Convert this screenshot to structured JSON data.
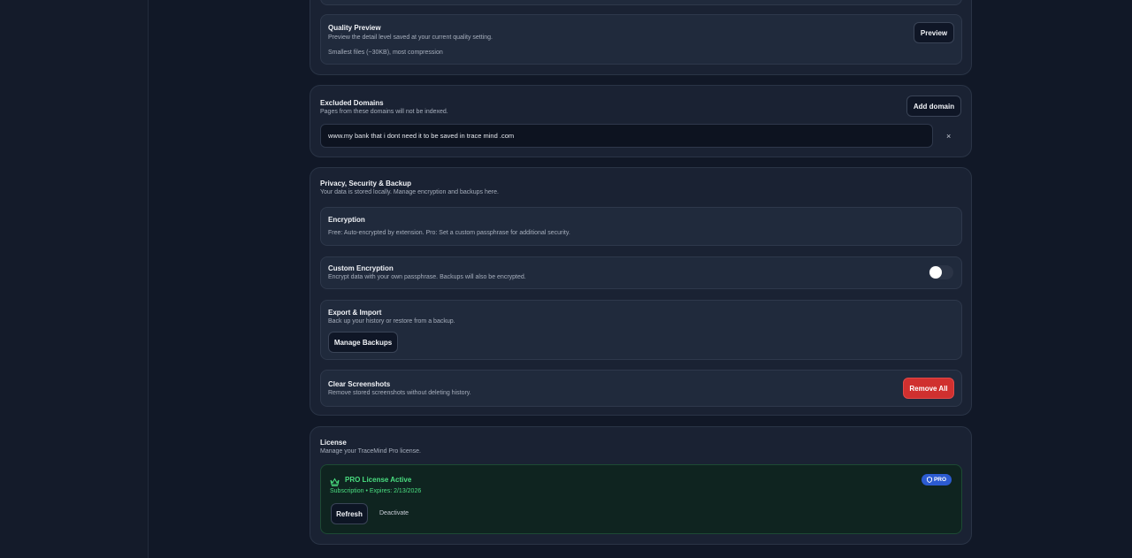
{
  "quality_preview": {
    "title": "Quality Preview",
    "description": "Preview the detail level saved at your current quality setting.",
    "note": "Smallest files (~30KB), most compression",
    "button": "Preview"
  },
  "excluded_domains": {
    "title": "Excluded Domains",
    "description": "Pages from these domains will not be indexed.",
    "add_button": "Add domain",
    "domain_value": "www.my bank that i dont need it to be saved in trace mind .com",
    "remove_glyph": "×"
  },
  "privacy": {
    "title": "Privacy, Security & Backup",
    "description": "Your data is stored locally. Manage encryption and backups here.",
    "encryption": {
      "title": "Encryption",
      "description": "Free: Auto-encrypted by extension. Pro: Set a custom passphrase for additional security."
    },
    "custom_encryption": {
      "title": "Custom Encryption",
      "description": "Encrypt data with your own passphrase. Backups will also be encrypted.",
      "enabled": false
    },
    "export_import": {
      "title": "Export & Import",
      "description": "Back up your history or restore from a backup.",
      "button": "Manage Backups"
    },
    "clear_screenshots": {
      "title": "Clear Screenshots",
      "description": "Remove stored screenshots without deleting history.",
      "button": "Remove All"
    }
  },
  "license": {
    "title": "License",
    "description": "Manage your TraceMind Pro license.",
    "status": "PRO License Active",
    "details": "Subscription • Expires: 2/13/2026",
    "badge": "PRO",
    "refresh_button": "Refresh",
    "deactivate_button": "Deactivate"
  },
  "colors": {
    "accent_green": "#4ade80",
    "danger": "#d0302f",
    "badge_blue": "#2c5bd1"
  }
}
